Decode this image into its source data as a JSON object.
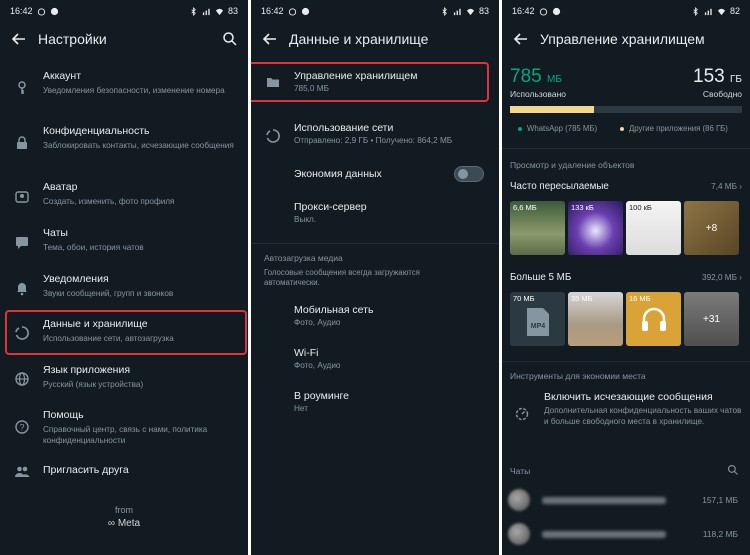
{
  "status": {
    "time": "16:42",
    "battery_1": "83",
    "battery_2": "83",
    "battery_3": "82"
  },
  "settings": {
    "title": "Настройки",
    "items": [
      {
        "title": "Аккаунт",
        "sub": "Уведомления безопасности, изменение номера",
        "icon": "key-icon"
      },
      {
        "title": "Конфиденциальность",
        "sub": "Заблокировать контакты, исчезающие сообщения",
        "icon": "lock-icon"
      },
      {
        "title": "Аватар",
        "sub": "Создать, изменить, фото профиля",
        "icon": "avatar-icon"
      },
      {
        "title": "Чаты",
        "sub": "Тема, обои, история чатов",
        "icon": "chat-icon"
      },
      {
        "title": "Уведомления",
        "sub": "Звуки сообщений, групп и звонков",
        "icon": "bell-icon"
      },
      {
        "title": "Данные и хранилище",
        "sub": "Использование сети, автозагрузка",
        "icon": "data-circle-icon"
      },
      {
        "title": "Язык приложения",
        "sub": "Русский (язык устройства)",
        "icon": "globe-icon"
      },
      {
        "title": "Помощь",
        "sub": "Справочный центр, связь с нами, политика конфиденциальности",
        "icon": "help-icon"
      },
      {
        "title": "Пригласить друга",
        "sub": "",
        "icon": "people-icon"
      }
    ],
    "from": "from",
    "meta": "∞ Meta"
  },
  "data_storage": {
    "title": "Данные и хранилище",
    "manage": {
      "title": "Управление хранилищем",
      "sub": "785,0 МБ"
    },
    "network": {
      "title": "Использование сети",
      "sub": "Отправлено: 2,9 ГБ • Получено: 864,2 МБ"
    },
    "saver": {
      "title": "Экономия данных"
    },
    "proxy": {
      "title": "Прокси-сервер",
      "sub": "Выкл."
    },
    "autoload_header": "Автозагрузка медиа",
    "autoload_note": "Голосовые сообщения всегда загружаются автоматически.",
    "mobile": {
      "title": "Мобильная сеть",
      "sub": "Фото, Аудио"
    },
    "wifi": {
      "title": "Wi-Fi",
      "sub": "Фото, Аудио"
    },
    "roaming": {
      "title": "В роуминге",
      "sub": "Нет"
    }
  },
  "storage": {
    "title": "Управление хранилищем",
    "used_num": "785",
    "used_unit": "МБ",
    "used_label": "Использовано",
    "free_num": "153",
    "free_unit": "ГБ",
    "free_label": "Свободно",
    "whatsapp_fraction": 0.36,
    "legend_wa": "WhatsApp (785 МБ)",
    "legend_other": "Другие приложения (86 ГБ)",
    "review_header": "Просмотр и удаление объектов",
    "forwarded": {
      "title": "Часто пересылаемые",
      "size": "7,4 МБ ›"
    },
    "forwarded_thumbs": [
      "6,6 МБ",
      "133 кБ",
      "100 кБ",
      "+8"
    ],
    "large": {
      "title": "Больше 5 МБ",
      "size": "392,0 МБ ›"
    },
    "large_thumbs": [
      "70 МБ",
      "35 МБ",
      "16 МБ",
      "+31"
    ],
    "mp4": "MP4",
    "tools_header": "Инструменты для экономии места",
    "disappearing_title": "Включить исчезающие сообщения",
    "disappearing_sub": "Дополнительная конфиденциальность ваших чатов и больше свободного места в хранилище.",
    "chats_header": "Чаты",
    "chat_sizes": [
      "157,1 МБ",
      "118,2 МБ"
    ],
    "colors": {
      "accent": "#00a884",
      "bar": "#f1d78f",
      "bg": "#121b22"
    }
  }
}
